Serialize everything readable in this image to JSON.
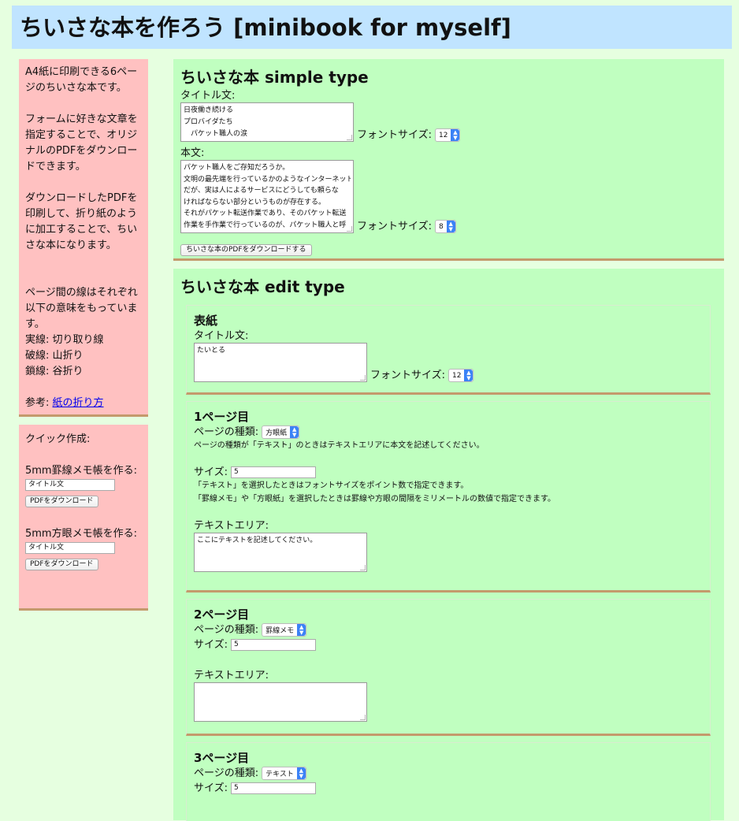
{
  "header": {
    "title": "ちいさな本を作ろう [minibook for myself]"
  },
  "sidebar": {
    "intro": {
      "p1": "A4紙に印刷できる6ページのちいさな本です。",
      "p2": "フォームに好きな文章を指定することで、オリジナルのPDFをダウンロードできます。",
      "p3": "ダウンロードしたPDFを印刷して、折り紙のように加工することで、ちいさな本になります。",
      "p4": "ページ間の線はそれぞれ以下の意味をもっています。",
      "solid": "実線: 切り取り線",
      "dashed": "破線: 山折り",
      "chain": "鎖線: 谷折り",
      "ref_prefix": "参考: ",
      "ref_link": "紙の折り方"
    },
    "quick": {
      "title": "クイック作成:",
      "ruled_title": "5mm罫線メモ帳を作る:",
      "ruled_placeholder": "タイトル文",
      "ruled_button": "PDFをダウンロード",
      "grid_title": "5mm方眼メモ帳を作る:",
      "grid_placeholder": "タイトル文",
      "grid_button": "PDFをダウンロード"
    }
  },
  "simple": {
    "heading": "ちいさな本 simple type",
    "title_label": "タイトル文:",
    "title_lines": [
      "日夜働き続ける",
      "プロバイダたち",
      "　パケット職人の涙"
    ],
    "fontsize_label": "フォントサイズ:",
    "title_fontsize": "12",
    "body_label": "本文:",
    "body_lines": [
      "パケット職人をご存知だろうか。",
      "文明の最先端を行っているかのようなインターネット",
      "だが、実は人によるサービスにどうしても頼らな",
      "ければならない部分というものが存在する。",
      "それがパケット転送作業であり、そのパケット転送",
      "作業を手作業で行っているのが、パケット職人と呼"
    ],
    "body_fontsize": "8",
    "download_button": "ちいさな本のPDFをダウンロードする"
  },
  "edit": {
    "heading": "ちいさな本 edit type",
    "cover": {
      "title": "表紙",
      "title_label": "タイトル文:",
      "title_value": "たいとる",
      "fontsize_label": "フォントサイズ:",
      "fontsize": "12"
    },
    "page1": {
      "title": "1ページ目",
      "type_label": "ページの種類:",
      "type_value": "方眼紙",
      "type_note": "ページの種類が「テキスト」のときはテキストエリアに本文を記述してください。",
      "size_label": "サイズ:",
      "size_value": "5",
      "size_note1": "「テキスト」を選択したときはフォントサイズをポイント数で指定できます。",
      "size_note2": "「罫線メモ」や「方眼紙」を選択したときは罫線や方眼の間隔をミリメートルの数値で指定できます。",
      "textarea_label": "テキストエリア:",
      "textarea_placeholder": "ここにテキストを記述してください。"
    },
    "page2": {
      "title": "2ページ目",
      "type_label": "ページの種類:",
      "type_value": "罫線メモ",
      "size_label": "サイズ:",
      "size_value": "5",
      "textarea_label": "テキストエリア:"
    },
    "page3": {
      "title": "3ページ目",
      "type_label": "ページの種類:",
      "type_value": "テキスト",
      "size_label": "サイズ:",
      "size_value": "5"
    }
  }
}
